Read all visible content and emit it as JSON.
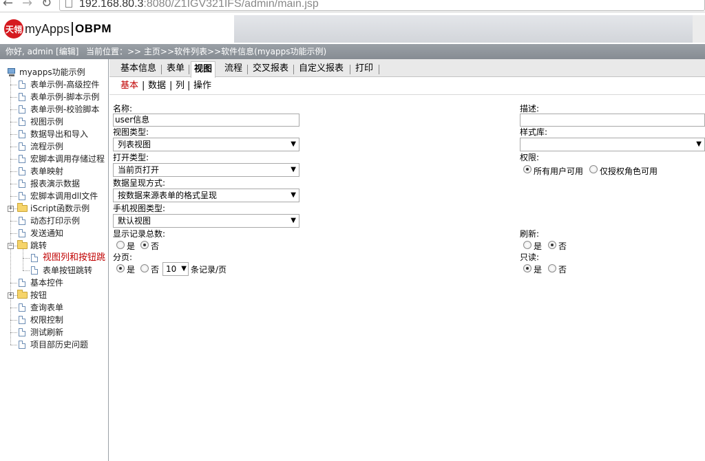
{
  "browser": {
    "url_host": "192.168.80.3",
    "url_rest": ":8080/Z1IGV321IFS/admin/main.jsp",
    "back_glyph": "←",
    "forward_glyph": "→",
    "reload_glyph": "↻"
  },
  "header": {
    "logo_mark": "天翎",
    "brand": "myApps",
    "product": "OBPM"
  },
  "status": {
    "greeting": "你好, admin [编辑]",
    "location": "当前位置：>> 主页>>软件列表>>软件信息(myapps功能示例)"
  },
  "sidebar": {
    "root": "myapps功能示例",
    "items": [
      {
        "label": "表单示例-高级控件"
      },
      {
        "label": "表单示例-脚本示例"
      },
      {
        "label": "表单示例-校验脚本"
      },
      {
        "label": "视图示例"
      },
      {
        "label": "数据导出和导入"
      },
      {
        "label": "流程示例"
      },
      {
        "label": "宏脚本调用存储过程"
      },
      {
        "label": "表单映射"
      },
      {
        "label": "报表演示数据"
      },
      {
        "label": "宏脚本调用dll文件"
      },
      {
        "label": "iScript函数示例"
      },
      {
        "label": "动态打印示例"
      },
      {
        "label": "发送通知"
      },
      {
        "label": "跳转"
      },
      {
        "label": "视图列和按钮跳"
      },
      {
        "label": "表单按钮跳转"
      },
      {
        "label": "基本控件"
      },
      {
        "label": "按钮"
      },
      {
        "label": "查询表单"
      },
      {
        "label": "权限控制"
      },
      {
        "label": "测试刷新"
      },
      {
        "label": "项目部历史问题"
      }
    ]
  },
  "tabs": [
    "基本信息",
    "表单",
    "视图",
    "流程",
    "交叉报表",
    "自定义报表",
    "打印"
  ],
  "subtabs": [
    "基本",
    "数据",
    "列",
    "操作"
  ],
  "form": {
    "name_label": "名称:",
    "name_value": "user信息",
    "view_type_label": "视图类型:",
    "view_type_value": "列表视图",
    "open_type_label": "打开类型:",
    "open_type_value": "当前页打开",
    "data_display_label": "数据呈现方式:",
    "data_display_value": "按数据来源表单的格式呈现",
    "mobile_view_label": "手机视图类型:",
    "mobile_view_value": "默认视图",
    "show_total_label": "显示记录总数:",
    "yes": "是",
    "no": "否",
    "paging_label": "分页:",
    "page_size_value": "10",
    "per_page_suffix": "条记录/页",
    "desc_label": "描述:",
    "style_lib_label": "样式库:",
    "permission_label": "权限:",
    "perm_all": "所有用户可用",
    "perm_roles": "仅授权角色可用",
    "refresh_label": "刷新:",
    "readonly_label": "只读:"
  },
  "dropdown_arrow": "▼"
}
